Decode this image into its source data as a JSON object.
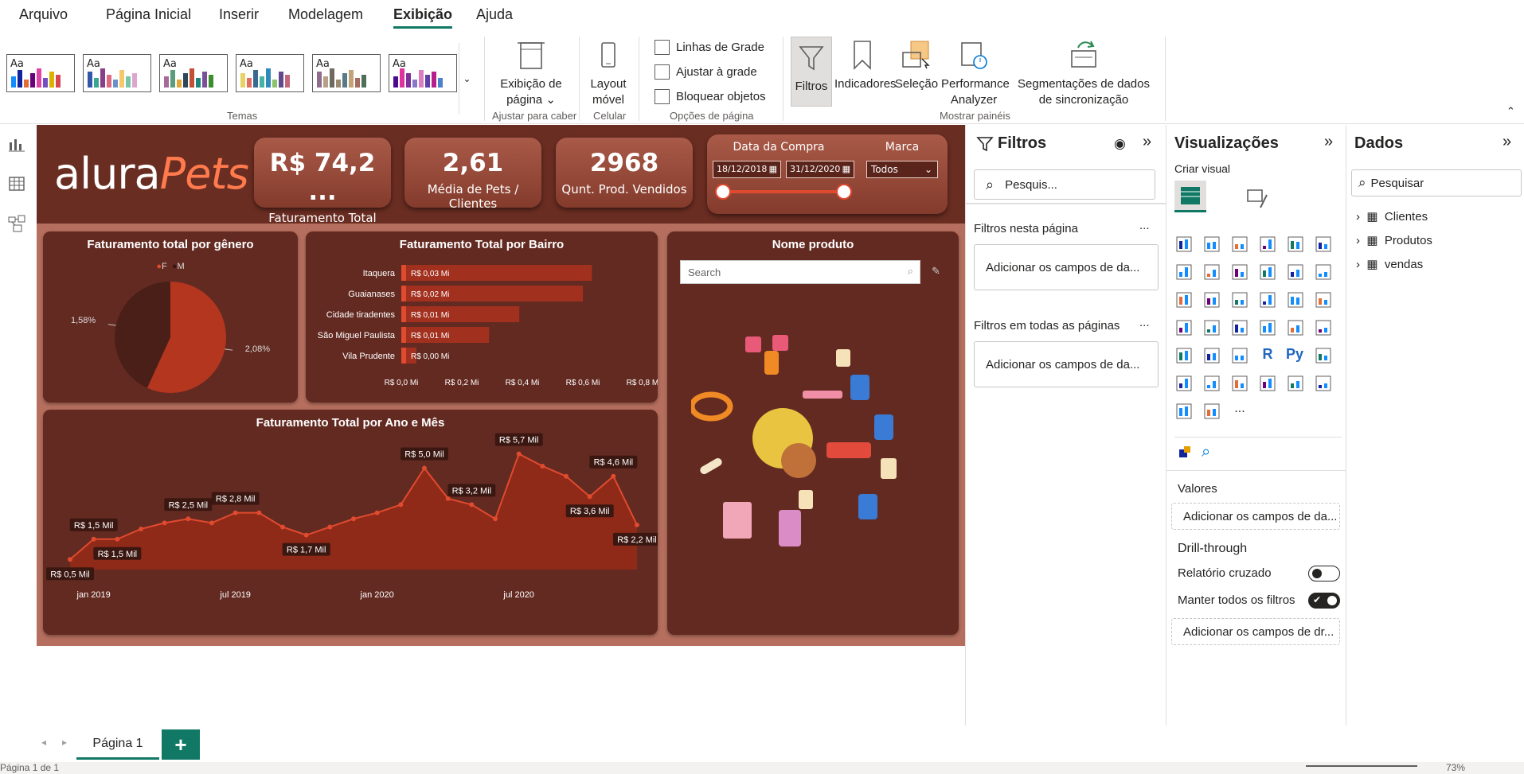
{
  "menu": {
    "items": [
      "Arquivo",
      "Página Inicial",
      "Inserir",
      "Modelagem",
      "Exibição",
      "Ajuda"
    ],
    "active": "Exibição"
  },
  "ribbon": {
    "groups": {
      "temas": "Temas",
      "ajustar": "Ajustar para caber",
      "celular": "Celular",
      "opcoes": "Opções de página",
      "mostrar": "Mostrar painéis"
    },
    "page_view_label": "Exibição de página",
    "mobile_layout_label": "Layout móvel",
    "gridlines_label": "Linhas de Grade",
    "snap_label": "Ajustar à grade",
    "lock_label": "Bloquear objetos",
    "filters_label": "Filtros",
    "bookmarks_label": "Indicadores",
    "selection_label": "Seleção",
    "performance_label": "Performance Analyzer",
    "sync_label": "Segmentações de dados de sincronização",
    "theme_aa": "Aa"
  },
  "report": {
    "logo_left": "alura",
    "logo_right": "Pets",
    "kpis": [
      {
        "value": "R$ 74,2 ...",
        "label": "Faturamento Total"
      },
      {
        "value": "2,61",
        "label": "Média de Pets / Clientes"
      },
      {
        "value": "2968",
        "label": "Qunt. Prod. Vendidos"
      }
    ],
    "date_slicer": {
      "title": "Data da Compra",
      "from": "18/12/2018",
      "to": "31/12/2020"
    },
    "brand_slicer": {
      "title": "Marca",
      "value": "Todos"
    },
    "product_card": {
      "title": "Nome produto",
      "search_placeholder": "Search"
    }
  },
  "chart_data": [
    {
      "type": "pie",
      "title": "Faturamento total por gênero",
      "legend": [
        "F",
        "M"
      ],
      "labels": [
        "F",
        "M"
      ],
      "values": [
        2.08,
        1.58
      ],
      "data_labels": [
        "2,08%",
        "1,58%"
      ],
      "colors": [
        "#b5361f",
        "#4a1f17"
      ]
    },
    {
      "type": "bar",
      "title": "Faturamento Total por Bairro",
      "categories": [
        "Itaquera",
        "Guaianases",
        "Cidade tiradentes",
        "São Miguel Paulista",
        "Vila Prudente"
      ],
      "values": [
        0.63,
        0.6,
        0.39,
        0.29,
        0.05
      ],
      "data_labels": [
        "R$ 0,03 Mi",
        "R$ 0,02 Mi",
        "R$ 0,01 Mi",
        "R$ 0,01 Mi",
        "R$ 0,00 Mi"
      ],
      "x_ticks": [
        "R$ 0,0 Mi",
        "R$ 0,2 Mi",
        "R$ 0,4 Mi",
        "R$ 0,6 Mi",
        "R$ 0,8 Mi"
      ],
      "xlim": [
        0,
        0.8
      ]
    },
    {
      "type": "area",
      "title": "Faturamento Total por Ano e Mês",
      "x": [
        "2018-12",
        "2019-01",
        "2019-02",
        "2019-03",
        "2019-04",
        "2019-05",
        "2019-06",
        "2019-07",
        "2019-08",
        "2019-09",
        "2019-10",
        "2019-11",
        "2019-12",
        "2020-01",
        "2020-02",
        "2020-03",
        "2020-04",
        "2020-05",
        "2020-06",
        "2020-07",
        "2020-08",
        "2020-09",
        "2020-10",
        "2020-11",
        "2020-12"
      ],
      "values": [
        0.5,
        1.5,
        1.5,
        2.0,
        2.3,
        2.5,
        2.3,
        2.8,
        2.8,
        2.1,
        1.7,
        2.1,
        2.5,
        2.8,
        3.2,
        5.0,
        3.5,
        3.2,
        2.5,
        5.7,
        5.1,
        4.6,
        3.6,
        4.6,
        2.2
      ],
      "data_labels": [
        {
          "i": 0,
          "text": "R$ 0,5 Mil"
        },
        {
          "i": 1,
          "text": "R$ 1,5 Mil"
        },
        {
          "i": 2,
          "text": "R$ 1,5 Mil"
        },
        {
          "i": 5,
          "text": "R$ 2,5 Mil"
        },
        {
          "i": 7,
          "text": "R$ 2,8 Mil"
        },
        {
          "i": 10,
          "text": "R$ 1,7 Mil"
        },
        {
          "i": 15,
          "text": "R$ 5,0 Mil"
        },
        {
          "i": 17,
          "text": "R$ 3,2 Mil"
        },
        {
          "i": 19,
          "text": "R$ 5,7 Mil"
        },
        {
          "i": 22,
          "text": "R$ 3,6 Mil"
        },
        {
          "i": 23,
          "text": "R$ 4,6 Mil"
        },
        {
          "i": 24,
          "text": "R$ 2,2 Mil"
        }
      ],
      "x_ticks": [
        {
          "i": 1,
          "text": "jan 2019"
        },
        {
          "i": 7,
          "text": "jul 2019"
        },
        {
          "i": 13,
          "text": "jan 2020"
        },
        {
          "i": 19,
          "text": "jul 2020"
        }
      ],
      "ylim": [
        0,
        6
      ]
    }
  ],
  "filters": {
    "title": "Filtros",
    "search_placeholder": "Pesquis...",
    "this_page": "Filtros nesta página",
    "all_pages": "Filtros em todas as páginas",
    "add_fields": "Adicionar os campos de da...",
    "more": "..."
  },
  "viz": {
    "title": "Visualizações",
    "build": "Criar visual",
    "values": "Valores",
    "add_values": "Adicionar os campos de da...",
    "drill": "Drill-through",
    "cross": "Relatório cruzado",
    "keep": "Manter todos os filtros",
    "add_drill": "Adicionar os campos de dr...",
    "r_label": "R",
    "py_label": "Py",
    "more": "..."
  },
  "data": {
    "title": "Dados",
    "search_placeholder": "Pesquisar",
    "tables": [
      "Clientes",
      "Produtos",
      "vendas"
    ]
  },
  "tabs": {
    "page": "Página 1",
    "add": "+"
  },
  "status": {
    "text": "Página 1 de 1",
    "zoom": "73%"
  }
}
